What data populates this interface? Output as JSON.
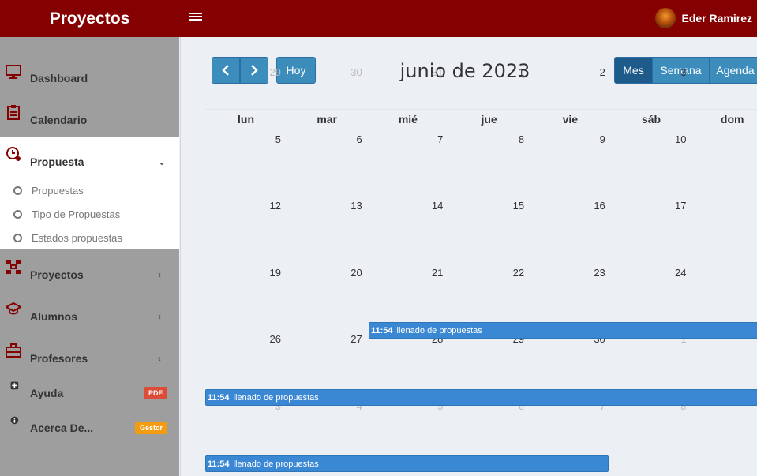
{
  "header": {
    "brand": "Proyectos",
    "user_name": "Eder Ramirez"
  },
  "sidebar": {
    "items": [
      {
        "label": "Dashboard"
      },
      {
        "label": "Calendario"
      },
      {
        "label": "Propuesta"
      },
      {
        "label": "Proyectos"
      },
      {
        "label": "Alumnos"
      },
      {
        "label": "Profesores"
      },
      {
        "label": "Ayuda",
        "badge": "PDF"
      },
      {
        "label": "Acerca De...",
        "badge": "Gestor"
      }
    ],
    "subitems": [
      {
        "label": "Propuestas"
      },
      {
        "label": "Tipo de Propuestas"
      },
      {
        "label": "Estados propuestas"
      }
    ]
  },
  "calendar": {
    "title": "junio de 2023",
    "today_label": "Hoy",
    "views": {
      "month": "Mes",
      "week": "Semana",
      "agenda": "Agenda"
    },
    "active_view": "Mes",
    "weekdays": [
      "lun",
      "mar",
      "mié",
      "jue",
      "vie",
      "sáb",
      "dom"
    ],
    "weeks": [
      [
        "29",
        "30",
        "31",
        "1",
        "2",
        "3",
        ""
      ],
      [
        "5",
        "6",
        "7",
        "8",
        "9",
        "10",
        ""
      ],
      [
        "12",
        "13",
        "14",
        "15",
        "16",
        "17",
        ""
      ],
      [
        "19",
        "20",
        "21",
        "22",
        "23",
        "24",
        ""
      ],
      [
        "26",
        "27",
        "28",
        "29",
        "30",
        "1",
        ""
      ],
      [
        "3",
        "4",
        "5",
        "6",
        "7",
        "8",
        ""
      ]
    ],
    "events": [
      {
        "time": "11:54",
        "title": "llenado de propuestas"
      },
      {
        "time": "11:54",
        "title": "llenado de propuestas"
      },
      {
        "time": "11:54",
        "title": "llenado de propuestas"
      }
    ]
  },
  "colors": {
    "header": "#850000",
    "sidebar": "#9e9e9e",
    "accent": "#3c8dbc",
    "event": "#3a87d4"
  }
}
